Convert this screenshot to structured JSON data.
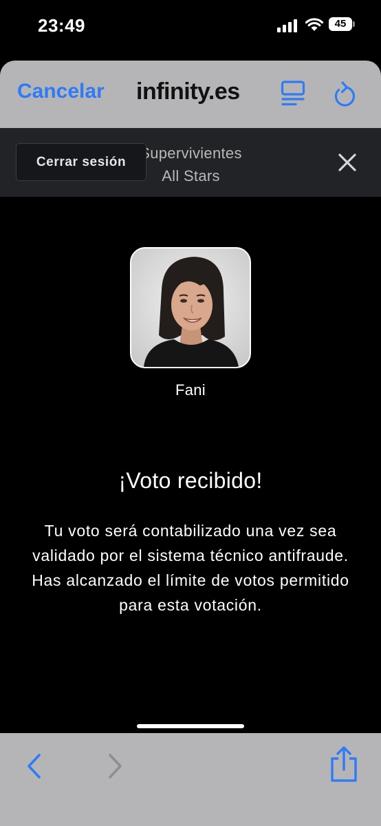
{
  "status_bar": {
    "time": "23:49",
    "battery_level": "45"
  },
  "nav_bar": {
    "cancel_label": "Cancelar",
    "domain": "infinity.es"
  },
  "sub_header": {
    "logout_label": "Cerrar sesión",
    "program_title_line1": "Supervivientes",
    "program_title_line2": "All Stars"
  },
  "contestant": {
    "name": "Fani"
  },
  "result": {
    "title": "¡Voto recibido!",
    "message": "Tu voto será contabilizado una vez sea validado por el sistema técnico antifraude. Has alcanzado el límite de votos permitido para esta votación."
  },
  "icons": {
    "reader": "reader-view-icon",
    "reload": "reload-icon",
    "close": "close-icon",
    "back": "chevron-left-icon",
    "forward": "chevron-right-icon",
    "share": "share-icon",
    "signal": "cellular-signal-icon",
    "wifi": "wifi-icon",
    "battery": "battery-icon"
  },
  "colors": {
    "accent": "#2f7bf5",
    "chrome": "#b5b5b7",
    "header_bg": "#212326",
    "background": "#000000"
  }
}
